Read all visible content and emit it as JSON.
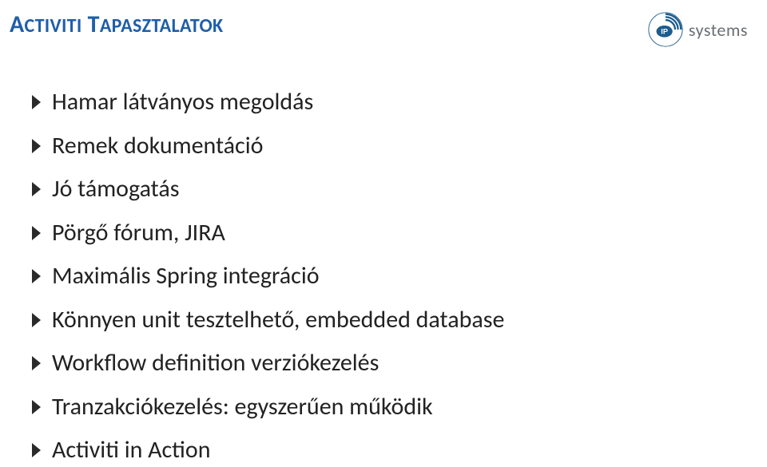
{
  "header": {
    "title_leading": "A",
    "title_rest_first_word": "CTIVITI",
    "title_leading2": "T",
    "title_rest_second_word": "APASZTALATOK"
  },
  "logo": {
    "badge_text": "IP",
    "brand_text": "systems"
  },
  "bullets": [
    "Hamar látványos megoldás",
    "Remek dokumentáció",
    "Jó támogatás",
    "Pörgő fórum, JIRA",
    "Maximális Spring integráció",
    "Könnyen unit tesztelhető, embedded database",
    "Workflow definition verziókezelés",
    "Tranzakciókezelés: egyszerűen működik",
    "Activiti in Action"
  ]
}
